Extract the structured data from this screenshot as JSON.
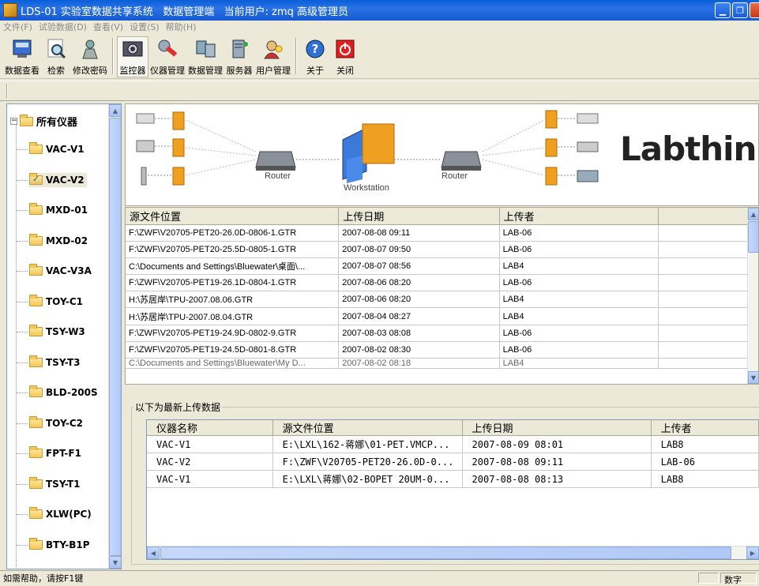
{
  "window": {
    "title": "LDS-01 实验室数据共享系统   数据管理端   当前用户: zmq 高级管理员"
  },
  "menu": [
    "文件(F)",
    "试验数据(D)",
    "查看(V)",
    "设置(S)",
    "帮助(H)"
  ],
  "toolbar": {
    "items": [
      {
        "label": "数据查看",
        "icon": "data-view-icon"
      },
      {
        "label": "检索",
        "icon": "search-icon"
      },
      {
        "label": "修改密码",
        "icon": "change-password-icon"
      },
      {
        "label": "监控器",
        "icon": "monitor-icon"
      },
      {
        "label": "仪器管理",
        "icon": "instrument-icon"
      },
      {
        "label": "数据管理",
        "icon": "data-manage-icon"
      },
      {
        "label": "服务器",
        "icon": "server-icon"
      },
      {
        "label": "用户管理",
        "icon": "users-icon"
      },
      {
        "label": "关于",
        "icon": "help-icon"
      },
      {
        "label": "关闭",
        "icon": "power-icon"
      }
    ]
  },
  "tree": {
    "root": "所有仪器",
    "items": [
      "VAC-V1",
      "VAC-V2",
      "MXD-01",
      "MXD-02",
      "VAC-V3A",
      "TOY-C1",
      "TSY-W3",
      "TSY-T3",
      "BLD-200S",
      "TOY-C2",
      "FPT-F1",
      "TSY-T1",
      "XLW(PC)",
      "BTY-B1P"
    ],
    "selected": "VAC-V2"
  },
  "banner": {
    "brand": "Labthink",
    "router_left": "Router",
    "workstation": "Workstation",
    "router_right": "Router"
  },
  "uploads": {
    "columns": [
      "源文件位置",
      "上传日期",
      "上传者",
      ""
    ],
    "rows": [
      [
        "F:\\ZWF\\V20705-PET20-26.0D-0806-1.GTR",
        "2007-08-08 09:11",
        "LAB-06"
      ],
      [
        "F:\\ZWF\\V20705-PET20-25.5D-0805-1.GTR",
        "2007-08-07 09:50",
        "LAB-06"
      ],
      [
        "C:\\Documents and Settings\\Bluewater\\桌面\\...",
        "2007-08-07 08:56",
        "LAB4"
      ],
      [
        "F:\\ZWF\\V20705-PET19-26.1D-0804-1.GTR",
        "2007-08-06 08:20",
        "LAB-06"
      ],
      [
        "H:\\苏居岸\\TPU-2007.08.06.GTR",
        "2007-08-06 08:20",
        "LAB4"
      ],
      [
        "H:\\苏居岸\\TPU-2007.08.04.GTR",
        "2007-08-04 08:27",
        "LAB4"
      ],
      [
        "F:\\ZWF\\V20705-PET19-24.9D-0802-9.GTR",
        "2007-08-03 08:08",
        "LAB-06"
      ],
      [
        "F:\\ZWF\\V20705-PET19-24.5D-0801-8.GTR",
        "2007-08-02 08:30",
        "LAB-06"
      ],
      [
        "C:\\Documents and Settings\\Bluewater\\My D...",
        "2007-08-02 08:18",
        "LAB4"
      ]
    ]
  },
  "latest": {
    "title": "以下为最新上传数据",
    "columns": [
      "仪器名称",
      "源文件位置",
      "上传日期",
      "上传者"
    ],
    "rows": [
      [
        "VAC-V1",
        "E:\\LXL\\162-蒋娜\\01-PET.VMCP...",
        "2007-08-09 08:01",
        "LAB8"
      ],
      [
        "VAC-V2",
        "F:\\ZWF\\V20705-PET20-26.0D-0...",
        "2007-08-08 09:11",
        "LAB-06"
      ],
      [
        "VAC-V1",
        "E:\\LXL\\蒋娜\\02-BOPET 20UM-0...",
        "2007-08-08 08:13",
        "LAB8"
      ]
    ]
  },
  "status": {
    "help": "如需帮助，请按F1键",
    "num": "数字"
  }
}
